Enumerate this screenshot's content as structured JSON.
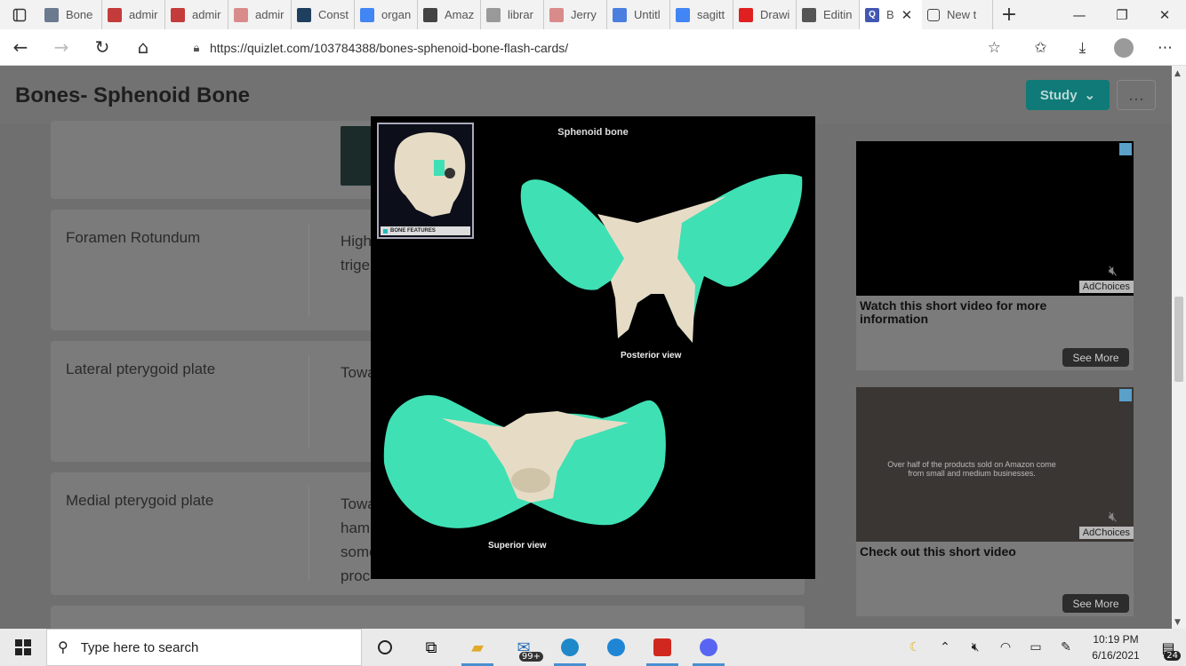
{
  "browser": {
    "tabs": [
      {
        "title": "Bone",
        "icon": "image-tab-icon",
        "color": "#6b7a8f"
      },
      {
        "title": "admir",
        "icon": "pdf-icon",
        "color": "#c43b3b"
      },
      {
        "title": "admir",
        "icon": "pdf-icon",
        "color": "#c43b3b"
      },
      {
        "title": "admir",
        "icon": "pdf-icon",
        "color": "#d98b8b"
      },
      {
        "title": "Const",
        "icon": "site-icon",
        "color": "#1f3f5f"
      },
      {
        "title": "organ",
        "icon": "google-icon",
        "color": "#4285f4"
      },
      {
        "title": "Amaz",
        "icon": "amazon-icon",
        "color": "#444444"
      },
      {
        "title": "librar",
        "icon": "page-icon",
        "color": "#999999"
      },
      {
        "title": "Jerry",
        "icon": "pdf-icon",
        "color": "#d98b8b"
      },
      {
        "title": "Untitl",
        "icon": "docs-icon",
        "color": "#4a7fe0"
      },
      {
        "title": "sagitt",
        "icon": "google-icon",
        "color": "#4285f4"
      },
      {
        "title": "Drawi",
        "icon": "youtube-icon",
        "color": "#e02020"
      },
      {
        "title": "Editin",
        "icon": "site-icon",
        "color": "#555555"
      }
    ],
    "active_tab": {
      "title": "B",
      "icon": "quizlet-icon",
      "color": "#4257b2"
    },
    "new_tab": {
      "title": "New t"
    },
    "url": "https://quizlet.com/103784388/bones-sphenoid-bone-flash-cards/"
  },
  "page": {
    "title": "Bones- Sphenoid Bone",
    "study_label": "Study",
    "more_label": "…",
    "cards": [
      {
        "term": "",
        "definition": ""
      },
      {
        "term": "Foramen Rotundum",
        "definition": "High\ntrige"
      },
      {
        "term": "Lateral pterygoid plate",
        "definition": "Towa"
      },
      {
        "term": "Medial pterygoid plate",
        "definition": "Towa\nhamu\nsome\nproc"
      },
      {
        "term": "",
        "definition": ""
      }
    ]
  },
  "ads": [
    {
      "caption": "Watch this short video for more information",
      "adchoices": "AdChoices",
      "see_more": "See More",
      "overlay": ""
    },
    {
      "caption": "Check out this short video",
      "adchoices": "AdChoices",
      "see_more": "See More",
      "overlay": "Over half of the products sold on Amazon come from small and medium businesses."
    }
  ],
  "modal": {
    "title": "Sphenoid bone",
    "posterior_label": "Posterior view",
    "superior_label": "Superior view",
    "inset_label": "BONE FEATURES",
    "highlight_color": "#3fe0b4",
    "bone_color": "#e6dcc6"
  },
  "taskbar": {
    "search_placeholder": "Type here to search",
    "mail_badge": "99+",
    "time": "10:19 PM",
    "date": "6/16/2021",
    "notification_count": "24"
  }
}
